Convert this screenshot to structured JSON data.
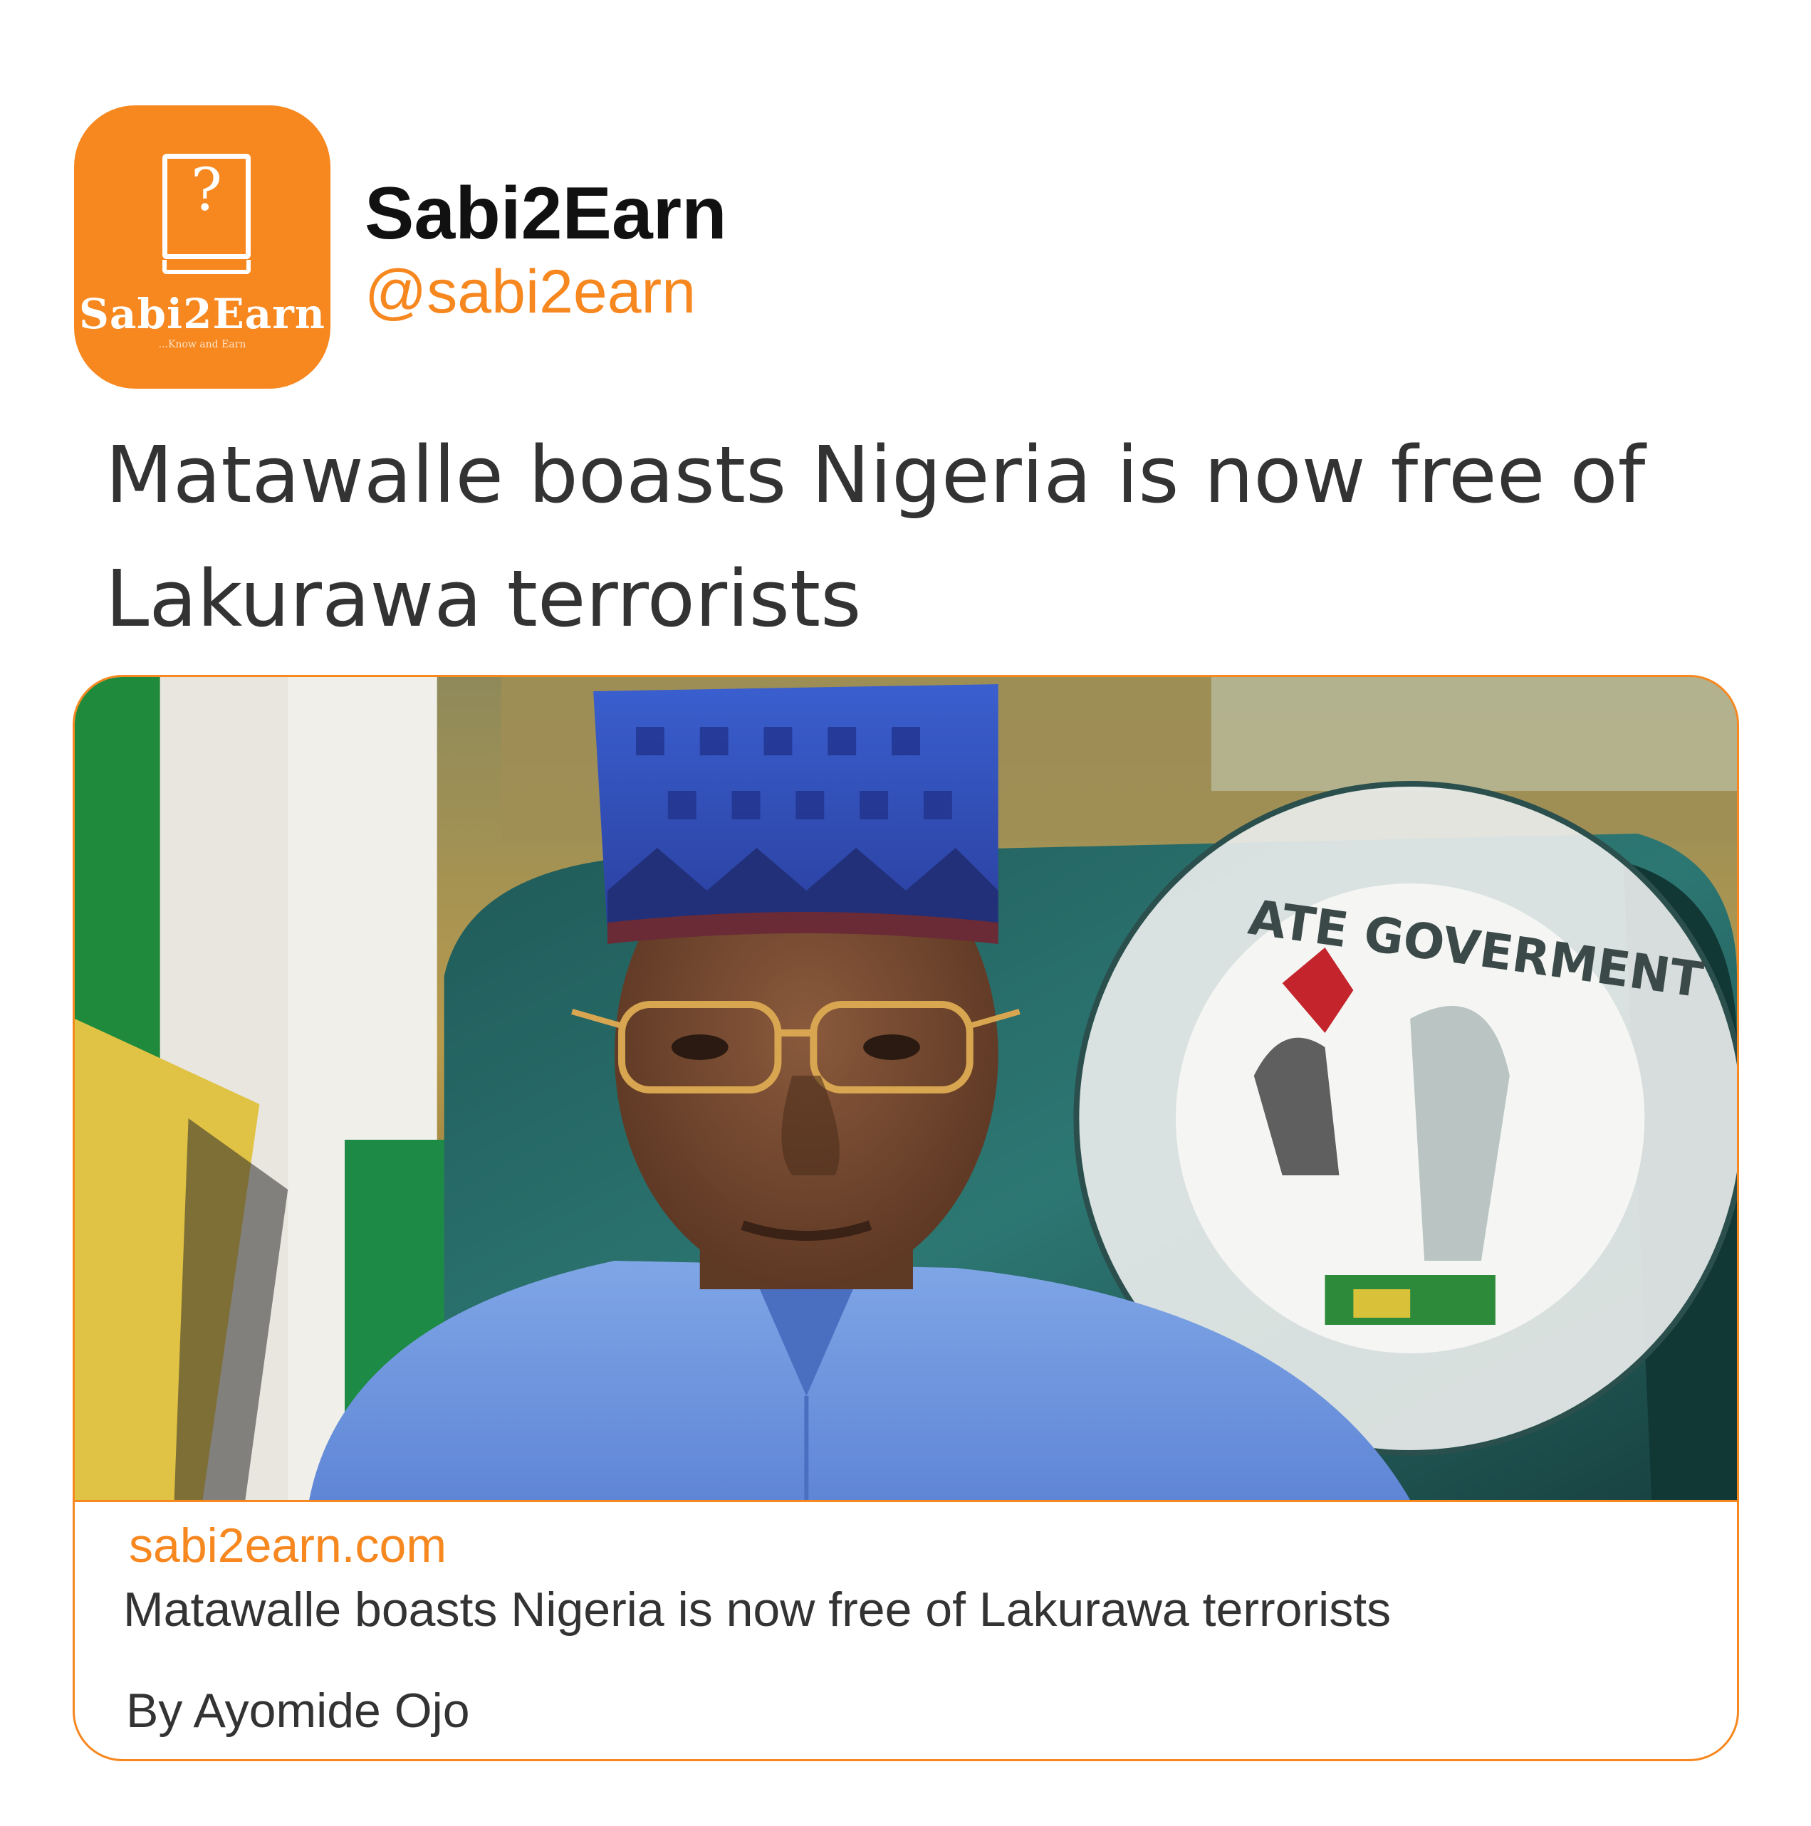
{
  "account": {
    "avatar_brand": "Sabi2Earn",
    "avatar_tagline": "...Know and Earn",
    "avatar_icon": "question-book-icon",
    "display_name": "Sabi2Earn",
    "handle": "@sabi2earn"
  },
  "tweet": {
    "text": "Matawalle boasts Nigeria is now free of Lakurawa terrorists"
  },
  "card": {
    "image_caption_seal_text": "STATE GOVERMENT · NIGERIA",
    "domain": "sabi2earn.com",
    "title": "Matawalle boasts Nigeria is now free of Lakurawa terrorists",
    "byline": "By Ayomide Ojo"
  },
  "colors": {
    "brand_orange": "#f7871f",
    "text_dark": "#111111",
    "text_body": "#333333",
    "background": "#ffffff"
  }
}
